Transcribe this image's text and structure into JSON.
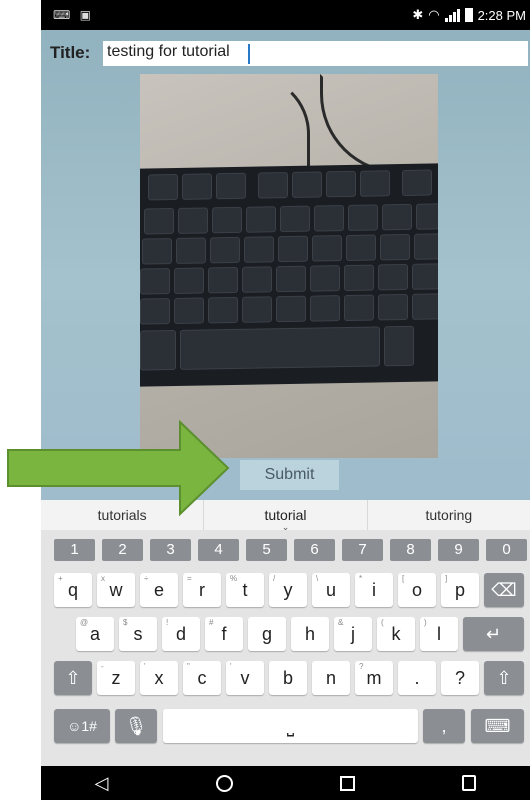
{
  "status_bar": {
    "time": "2:28 PM",
    "left_icons": [
      "keyboard-icon",
      "notification-icon"
    ],
    "right_icons": [
      "bluetooth-icon",
      "wifi-icon",
      "signal-icon",
      "battery-icon"
    ]
  },
  "form": {
    "title_label": "Title:",
    "title_value": "testing for tutorial"
  },
  "submit_label": "Submit",
  "suggestions": [
    "tutorials",
    "tutorial",
    "tutoring"
  ],
  "keyboard": {
    "numbers": [
      "1",
      "2",
      "3",
      "4",
      "5",
      "6",
      "7",
      "8",
      "9",
      "0"
    ],
    "row1": [
      "q",
      "w",
      "e",
      "r",
      "t",
      "y",
      "u",
      "i",
      "o",
      "p"
    ],
    "row1_sub": [
      "+",
      "x",
      "÷",
      "=",
      "%",
      "/",
      "\\",
      "*",
      "[",
      "]"
    ],
    "row2": [
      "a",
      "s",
      "d",
      "f",
      "g",
      "h",
      "j",
      "k",
      "l"
    ],
    "row2_sub": [
      "@",
      "$",
      "!",
      "#",
      "",
      "",
      "&",
      "(",
      ")"
    ],
    "row3": [
      "z",
      "x",
      "c",
      "v",
      "b",
      "n",
      "m",
      ".",
      "?"
    ],
    "row3_sub": [
      "-",
      "'",
      "\"",
      "'",
      "",
      "",
      "?",
      "",
      ""
    ],
    "sym_label": "☺1#",
    "comma": ","
  },
  "colors": {
    "accent_arrow": "#7ab540",
    "background": "#9fbcc9"
  }
}
